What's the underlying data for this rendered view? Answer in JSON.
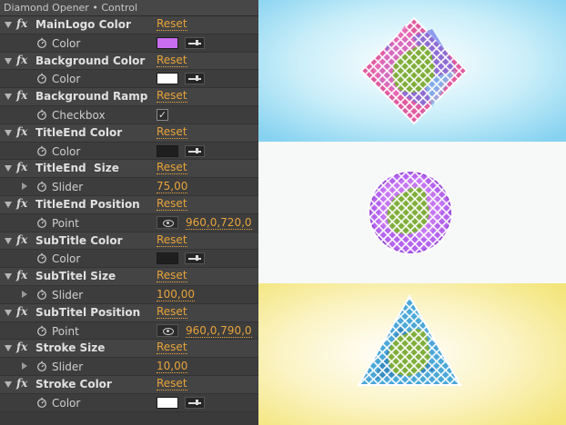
{
  "panel": {
    "title": "Diamond Opener • Control",
    "reset_label": "Reset"
  },
  "colors": {
    "accent": "#e8a33a",
    "scene_top_bg": "#9fdcf3",
    "scene_bottom_bg": "#f6ec93",
    "logo_purple": "#c46ff2"
  },
  "effects": [
    {
      "name": "MainLogo Color",
      "prop": {
        "label": "Color",
        "type": "color",
        "swatch": "#c86df0"
      }
    },
    {
      "name": "Background Color",
      "prop": {
        "label": "Color",
        "type": "color",
        "swatch": "#ffffff"
      }
    },
    {
      "name": "Background Ramp",
      "prop": {
        "label": "Checkbox",
        "type": "checkbox",
        "check": "✓"
      }
    },
    {
      "name": "TitleEnd Color",
      "prop": {
        "label": "Color",
        "type": "color",
        "swatch": "#1f1f1f"
      }
    },
    {
      "name": "TitleEnd  Size",
      "prop": {
        "label": "Slider",
        "type": "slider",
        "value": "75,00"
      }
    },
    {
      "name": "TitleEnd Position",
      "prop": {
        "label": "Point",
        "type": "point",
        "value": "960,0,720,0"
      }
    },
    {
      "name": "SubTitle Color",
      "prop": {
        "label": "Color",
        "type": "color",
        "swatch": "#1f1f1f"
      }
    },
    {
      "name": "SubTitel Size",
      "prop": {
        "label": "Slider",
        "type": "slider",
        "value": "100,00"
      }
    },
    {
      "name": "SubTitel Position",
      "prop": {
        "label": "Point",
        "type": "point",
        "value": "960,0,790,0"
      }
    },
    {
      "name": "Stroke Size",
      "prop": {
        "label": "Slider",
        "type": "slider",
        "value": "10,00"
      }
    },
    {
      "name": "Stroke Color",
      "prop": {
        "label": "Color",
        "type": "color",
        "swatch": "#ffffff"
      }
    }
  ]
}
